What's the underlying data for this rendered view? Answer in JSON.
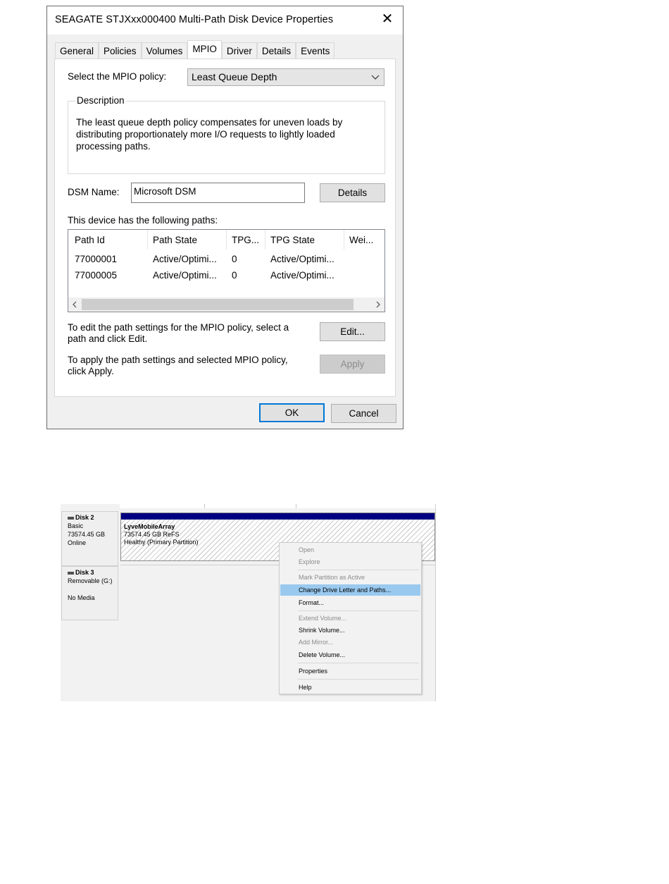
{
  "dialog": {
    "title": "SEAGATE STJXxx000400  Multi-Path Disk Device Properties",
    "tabs": [
      {
        "label": "General"
      },
      {
        "label": "Policies"
      },
      {
        "label": "Volumes"
      },
      {
        "label": "MPIO"
      },
      {
        "label": "Driver"
      },
      {
        "label": "Details"
      },
      {
        "label": "Events"
      }
    ],
    "active_tab": "MPIO",
    "policy_label": "Select the MPIO policy:",
    "policy_value": "Least Queue Depth",
    "description_title": "Description",
    "description_text": "The least queue depth policy compensates for uneven loads by distributing proportionately more I/O requests to lightly loaded processing paths.",
    "dsm_label": "DSM Name:",
    "dsm_value": "Microsoft DSM",
    "details_button": "Details",
    "paths_label": "This device has the following paths:",
    "columns": [
      "Path Id",
      "Path State",
      "TPG...",
      "TPG State",
      "Wei..."
    ],
    "rows": [
      [
        "77000001",
        "Active/Optimi...",
        "0",
        "Active/Optimi..."
      ],
      [
        "77000005",
        "Active/Optimi...",
        "0",
        "Active/Optimi..."
      ]
    ],
    "edit_text": "To edit the path settings for the MPIO policy, select a path and click Edit.",
    "edit_button": "Edit...",
    "apply_text": "To apply the path settings and selected MPIO policy, click Apply.",
    "apply_button": "Apply",
    "ok_button": "OK",
    "cancel_button": "Cancel"
  },
  "disk_management": {
    "disk2": {
      "name": "Disk 2",
      "type": "Basic",
      "size": "73574.45 GB",
      "status": "Online"
    },
    "disk3": {
      "name": "Disk 3",
      "type": "Removable (G:)",
      "status": "No Media"
    },
    "partition": {
      "name": "LyveMobileArray",
      "size_fs": "73574.45 GB ReFS",
      "health": "Healthy (Primary Partition)"
    },
    "context_menu": [
      {
        "label": "Open",
        "enabled": false
      },
      {
        "label": "Explore",
        "enabled": false
      },
      {
        "label": "Mark Partition as Active",
        "enabled": false
      },
      {
        "label": "Change Drive Letter and Paths...",
        "enabled": true,
        "selected": true
      },
      {
        "label": "Format...",
        "enabled": true
      },
      {
        "label": "Extend Volume...",
        "enabled": false
      },
      {
        "label": "Shrink Volume...",
        "enabled": true
      },
      {
        "label": "Add Mirror...",
        "enabled": false
      },
      {
        "label": "Delete Volume...",
        "enabled": true
      },
      {
        "label": "Properties",
        "enabled": true
      },
      {
        "label": "Help",
        "enabled": true
      }
    ]
  },
  "colors": {
    "focus_border": "#0078d7",
    "partition_bar": "#000080",
    "menu_highlight": "#99c9ef"
  }
}
